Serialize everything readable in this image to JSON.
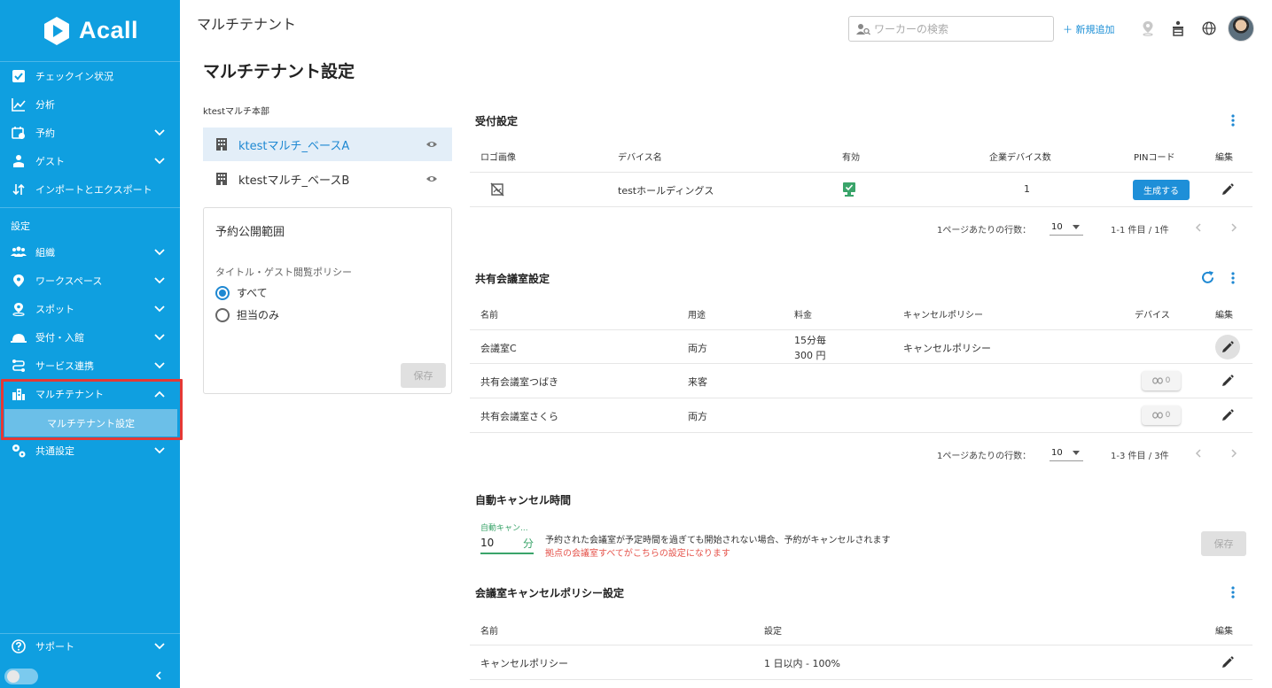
{
  "brand": {
    "name": "Acall"
  },
  "sidebar": {
    "items": [
      {
        "label": "チェックイン状況"
      },
      {
        "label": "分析"
      },
      {
        "label": "予約"
      },
      {
        "label": "ゲスト"
      },
      {
        "label": "インポートとエクスポート"
      }
    ],
    "section_label": "設定",
    "settings_items": [
      {
        "label": "組織"
      },
      {
        "label": "ワークスペース"
      },
      {
        "label": "スポット"
      },
      {
        "label": "受付・入館"
      },
      {
        "label": "サービス連携"
      },
      {
        "label": "マルチテナント"
      }
    ],
    "sub_item": "マルチテナント設定",
    "common_settings": "共通設定",
    "support": "サポート"
  },
  "header": {
    "title": "マルチテナント",
    "search_placeholder": "ワーカーの検索",
    "add_new": "＋ 新規追加"
  },
  "page": {
    "title": "マルチテナント設定"
  },
  "left_panel": {
    "hq_label": "ktestマルチ本部",
    "bases": [
      {
        "label": "ktestマルチ_ベースA"
      },
      {
        "label": "ktestマルチ_ベースB"
      }
    ],
    "scope_card": {
      "title": "予約公開範囲",
      "policy_label": "タイトル・ゲスト閲覧ポリシー",
      "options": [
        {
          "label": "すべて",
          "selected": true
        },
        {
          "label": "担当のみ",
          "selected": false
        }
      ],
      "save_label": "保存"
    }
  },
  "reception": {
    "title": "受付設定",
    "columns": [
      "ロゴ画像",
      "デバイス名",
      "有効",
      "企業デバイス数",
      "PINコード",
      "編集"
    ],
    "rows": [
      {
        "device_name": "testホールディングス",
        "enabled": true,
        "device_count": "1",
        "pin_label": "生成する"
      }
    ],
    "rows_per_page_label": "1ページあたりの行数：",
    "rows_per_page": "10",
    "range": "1-1 件目 / 1件"
  },
  "shared_rooms": {
    "title": "共有会議室設定",
    "columns": [
      "名前",
      "用途",
      "料金",
      "キャンセルポリシー",
      "デバイス",
      "編集"
    ],
    "rows": [
      {
        "name": "会議室C",
        "usage": "両方",
        "fee_line1": "15分毎",
        "fee_line2": "300 円",
        "policy": "キャンセルポリシー",
        "devices": ""
      },
      {
        "name": "共有会議室つばき",
        "usage": "来客",
        "fee_line1": "",
        "fee_line2": "",
        "policy": "",
        "devices": "0"
      },
      {
        "name": "共有会議室さくら",
        "usage": "両方",
        "fee_line1": "",
        "fee_line2": "",
        "policy": "",
        "devices": "0"
      }
    ],
    "rows_per_page_label": "1ページあたりの行数：",
    "rows_per_page": "10",
    "range": "1-3 件目 / 3件"
  },
  "auto_cancel": {
    "title": "自動キャンセル時間",
    "field_label": "自動キャン...",
    "value": "10",
    "unit": "分",
    "description": "予約された会議室が予定時間を過ぎても開始されない場合、予約がキャンセルされます",
    "warning": "拠点の会議室すべてがこちらの設定になります",
    "save_label": "保存"
  },
  "cancel_policy": {
    "title": "会議室キャンセルポリシー設定",
    "columns": [
      "名前",
      "設定",
      "編集"
    ],
    "rows": [
      {
        "name": "キャンセルポリシー",
        "setting": "1 日以内 - 100%"
      }
    ]
  },
  "colors": {
    "sidebar": "#0f9fe0",
    "accent": "#1e88d2",
    "warning": "#e5534b",
    "success": "#3aa46a"
  }
}
